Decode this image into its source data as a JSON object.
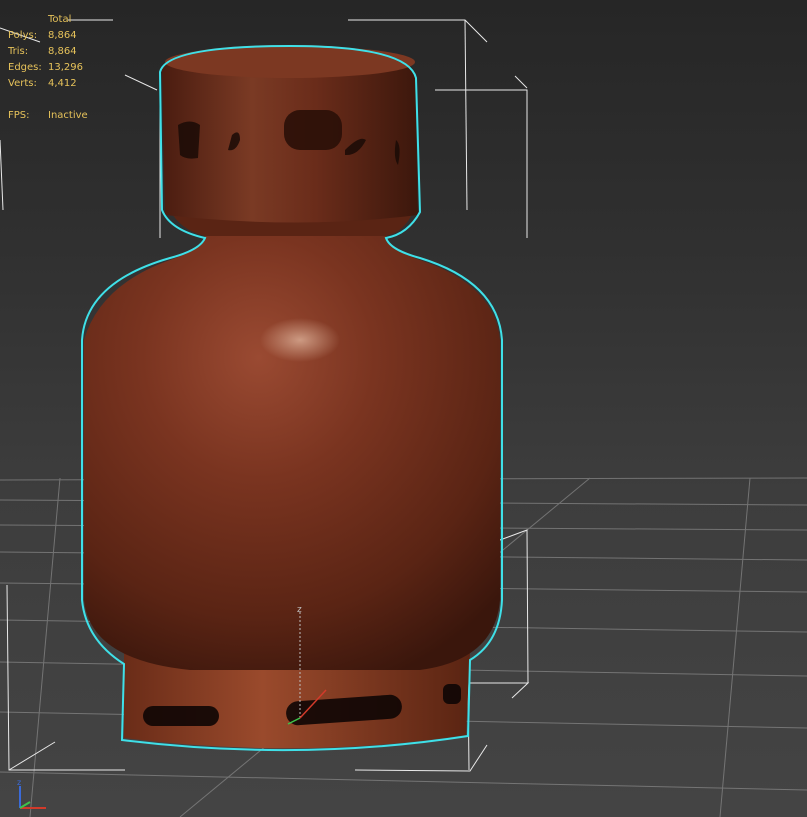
{
  "stats": {
    "header": "Total",
    "rows": [
      {
        "label": "Polys:",
        "value": "8,864"
      },
      {
        "label": "Tris:",
        "value": "8,864"
      },
      {
        "label": "Edges:",
        "value": "13,296"
      },
      {
        "label": "Verts:",
        "value": "4,412"
      }
    ],
    "fps_label": "FPS:",
    "fps_value": "Inactive"
  },
  "gizmo": {
    "z_label": "z"
  },
  "colors": {
    "stats_text": "#e6c25a",
    "selection_outline": "#3fe0e8",
    "bbox": "#e8e8e8",
    "grid": "#8a8a8a",
    "rust_base": "#6b2a18",
    "axis_x": "#d23a2a",
    "axis_y": "#3ec24a",
    "axis_z": "#3a6ad8"
  }
}
